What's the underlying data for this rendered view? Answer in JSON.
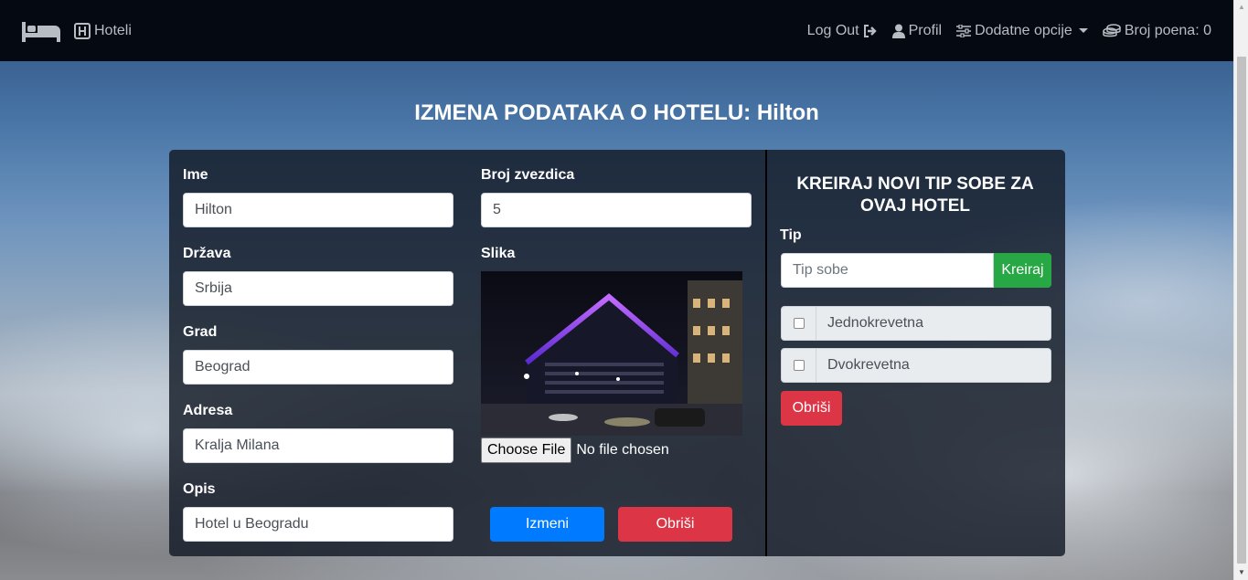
{
  "navbar": {
    "brand_label": "Hoteli",
    "logout_label": "Log Out",
    "profile_label": "Profil",
    "options_label": "Dodatne opcije",
    "points_label": "Broj poena: 0"
  },
  "page": {
    "title": "IZMENA PODATAKA O HOTELU: Hilton"
  },
  "form": {
    "name_label": "Ime",
    "name_value": "Hilton",
    "country_label": "Država",
    "country_value": "Srbija",
    "city_label": "Grad",
    "city_value": "Beograd",
    "address_label": "Adresa",
    "address_value": "Kralja Milana",
    "description_label": "Opis",
    "description_value": "Hotel u Beogradu",
    "stars_label": "Broj zvezdica",
    "stars_value": "5",
    "image_label": "Slika",
    "choose_file_label": "Choose File",
    "no_file_text": "No file chosen",
    "update_button": "Izmeni",
    "delete_button": "Obriši"
  },
  "room_types": {
    "title": "KREIRAJ NOVI TIP SOBE ZA OVAJ HOTEL",
    "type_label": "Tip",
    "type_placeholder": "Tip sobe",
    "create_button": "Kreiraj",
    "items": [
      {
        "label": "Jednokrevetna",
        "checked": false
      },
      {
        "label": "Dvokrevetna",
        "checked": false
      }
    ],
    "delete_button": "Obriši"
  },
  "colors": {
    "navbar_bg": "#050a12",
    "primary": "#007bff",
    "danger": "#dc3545",
    "success": "#28a745"
  }
}
